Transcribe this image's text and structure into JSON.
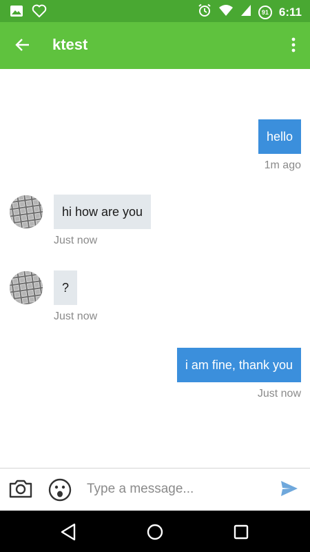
{
  "status_bar": {
    "time": "6:11",
    "battery_badge": "91",
    "icons": [
      "image-icon",
      "heart-outline-icon",
      "alarm-icon",
      "wifi-icon",
      "cell-signal-icon",
      "battery-icon"
    ]
  },
  "app_bar": {
    "title": "ktest",
    "back_icon": "arrow-left-icon",
    "menu_icon": "more-vertical-icon"
  },
  "messages": [
    {
      "direction": "outgoing",
      "text": "hello",
      "time": "1m ago"
    },
    {
      "direction": "incoming",
      "text": "hi how are you",
      "time": "Just now"
    },
    {
      "direction": "incoming",
      "text": "?",
      "time": "Just now"
    },
    {
      "direction": "outgoing",
      "text": "i am fine, thank you",
      "time": "Just now"
    }
  ],
  "composer": {
    "placeholder": "Type a message...",
    "value": "",
    "camera_icon": "camera-icon",
    "emoji_icon": "emoji-icon",
    "send_icon": "send-icon"
  },
  "nav": {
    "icons": [
      "back-triangle-icon",
      "home-circle-icon",
      "recents-square-icon"
    ]
  },
  "colors": {
    "status_bar": "#49a832",
    "app_bar": "#5fc23e",
    "outgoing_bubble": "#3b8fdc",
    "incoming_bubble": "#e3e8ec",
    "timestamp": "#8a8a8a",
    "send_icon": "#6fa8dc"
  }
}
